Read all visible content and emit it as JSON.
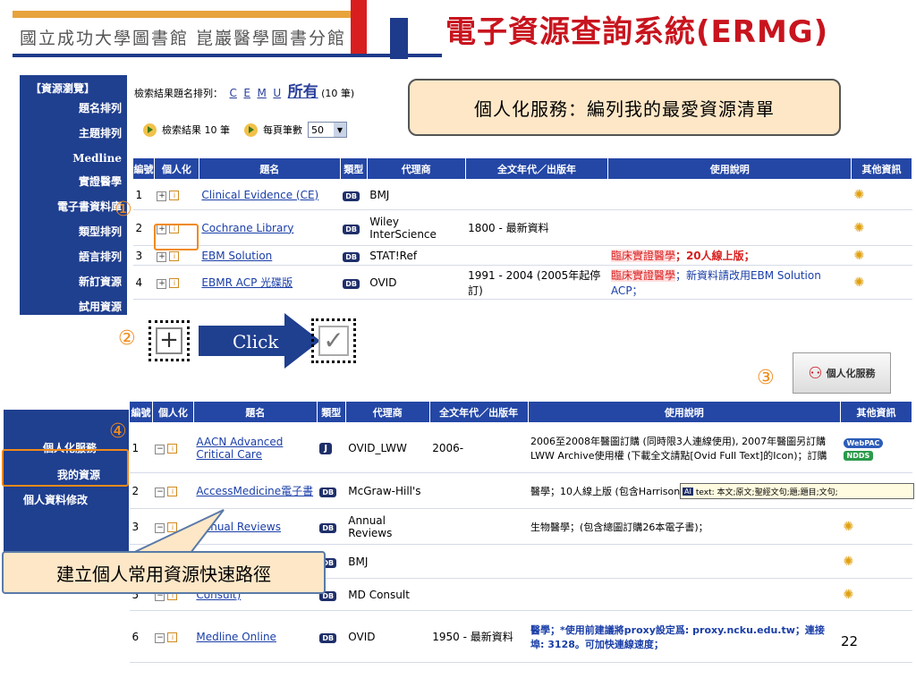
{
  "header": {
    "library_name": "國立成功大學圖書館 崑巖醫學圖書分館",
    "system_title": "電子資源查詢系統(ERMG)"
  },
  "top_sidebar": {
    "items": [
      "【資源瀏覽】",
      "題名排列",
      "主題排列",
      "Medline",
      "實證醫學",
      "電子書資料庫",
      "類型排列",
      "語言排列",
      "新訂資源",
      "試用資源"
    ]
  },
  "sort_line": {
    "prefix": "檢索結果題名排列：",
    "letters": [
      "C",
      "E",
      "M",
      "U"
    ],
    "all_label": "所有",
    "count": "(10 筆)"
  },
  "result_line": {
    "result_text": "檢索結果 10 筆",
    "per_page_label": "每頁筆數",
    "per_page_value": "50"
  },
  "callouts": {
    "top": "個人化服務：編列我的最愛資源清單",
    "bottom": "建立個人常用資源快速路徑",
    "click": "Click",
    "n1": "①",
    "n2": "②",
    "n3": "③",
    "n4": "④"
  },
  "top_table": {
    "headers": [
      "編號",
      "個人化",
      "題名",
      "類型",
      "代理商",
      "全文年代／出版年",
      "使用說明",
      "其他資訊"
    ],
    "rows": [
      {
        "no": "1",
        "title": "Clinical Evidence (CE)",
        "type": "DB",
        "vendor": "BMJ",
        "years": "",
        "note_red": "",
        "note_rest": ""
      },
      {
        "no": "2",
        "title": "Cochrane Library",
        "type": "DB",
        "vendor": "Wiley InterScience",
        "years": "1800 - 最新資料",
        "note_red": "",
        "note_rest": ""
      },
      {
        "no": "3",
        "title": "EBM Solution",
        "type": "DB",
        "vendor": "STAT!Ref",
        "years": "",
        "note_red": "臨床實證醫學",
        "note_rest": "；20人線上版；"
      },
      {
        "no": "4",
        "title": "EBMR ACP 光碟版",
        "type": "DB",
        "vendor": "OVID",
        "years": "1991 - 2004 (2005年起停訂)",
        "note_red": "臨床實證醫學",
        "note_rest": "；新資料請改用EBM Solution ACP；"
      }
    ]
  },
  "personal_button": {
    "label": "個人化服務"
  },
  "bottom_sidebar": {
    "items": [
      "個人化服務",
      "我的資源",
      "個人資料修改"
    ]
  },
  "bottom_table": {
    "headers": [
      "編號",
      "個人化",
      "題名",
      "類型",
      "代理商",
      "全文年代／出版年",
      "使用說明",
      "其他資訊"
    ],
    "rows": [
      {
        "no": "1",
        "title": "AACN Advanced Critical Care",
        "type": "J",
        "vendor": "OVID_LWW",
        "years": "2006-",
        "note": "2006至2008年醫圖訂購 (同時限3人連線使用), 2007年醫圖另訂購LWW Archive使用權 (下載全文請點[Ovid Full Text]的Icon)；訂購"
      },
      {
        "no": "2",
        "title": "AccessMedicine電子書",
        "type": "DB",
        "vendor": "McGraw-Hill's",
        "years": "",
        "note": "醫學；10人線上版 (包含Harrison's Online ...等53本醫學電子書)；"
      },
      {
        "no": "3",
        "title": "Annual Reviews",
        "type": "DB",
        "vendor": "Annual Reviews",
        "years": "",
        "note": "生物醫學；(包含總圖訂購26本電子書)；"
      },
      {
        "no": "4",
        "title": "",
        "type": "DB",
        "vendor": "BMJ",
        "years": "",
        "note": ""
      },
      {
        "no": "5",
        "title": "Consult)",
        "type": "DB",
        "vendor": "MD Consult",
        "years": "",
        "note": ""
      },
      {
        "no": "6",
        "title": "Medline Online",
        "type": "DB",
        "vendor": "OVID",
        "years": "1950 - 最新資料",
        "note": "醫學；*使用前建議將proxy設定爲: proxy.ncku.edu.tw；連接埠: 3128。可加快連線速度；"
      }
    ],
    "webpac": "WebPAC",
    "ndds": "NDDS"
  },
  "tooltip": {
    "icon": "AI",
    "text": "text: 本文;原文;聖經文句;題;題目;文句;"
  },
  "page_number": "22"
}
